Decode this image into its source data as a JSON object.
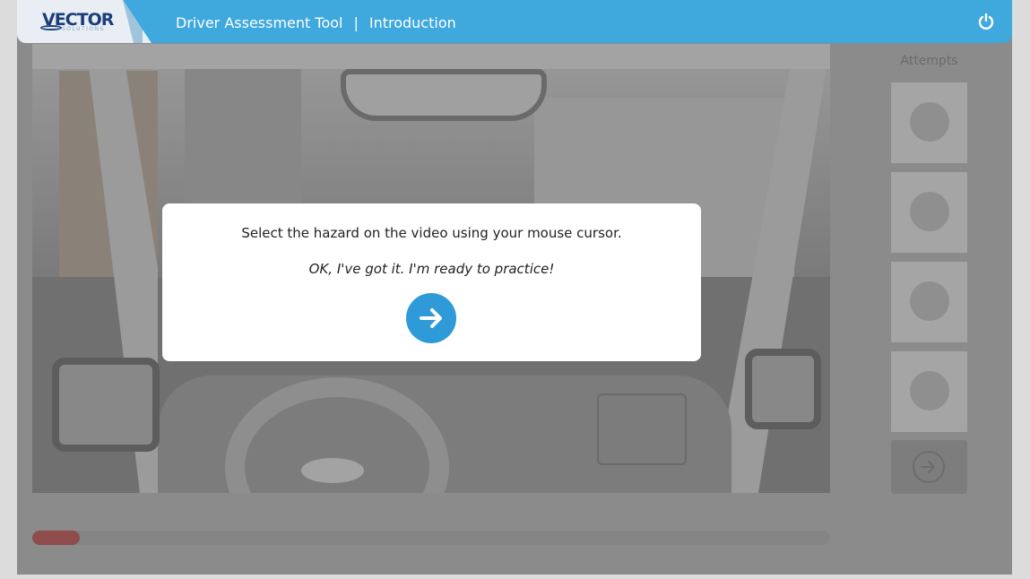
{
  "header": {
    "logo_text": "VECTOR",
    "logo_sub": "SOLUTIONS",
    "app_title": "Driver Assessment Tool",
    "separator": "|",
    "section": "Introduction",
    "power_icon": "power-icon"
  },
  "sidebar": {
    "title": "Attempts",
    "attempts": [
      "",
      "",
      "",
      ""
    ]
  },
  "modal": {
    "message": "Select the hazard on the video using your mouse cursor.",
    "sub_message": "OK, I've got it. I'm ready to practice!",
    "button_icon": "arrow-right-icon"
  },
  "progress": {
    "value_percent": 6
  },
  "colors": {
    "header_bg": "#3fa8dd",
    "accent": "#2e9ad8",
    "progress_fill": "#c95b5b",
    "overlay": "#8b8b8b"
  }
}
